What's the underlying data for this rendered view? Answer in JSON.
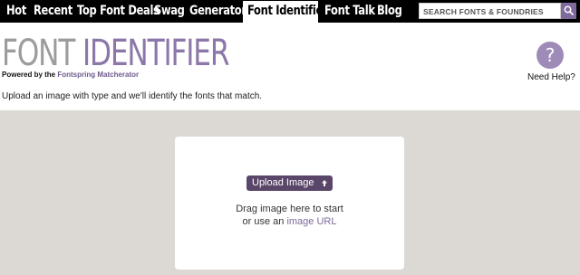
{
  "nav": {
    "items": [
      {
        "label": "Hot"
      },
      {
        "label": "Recent"
      },
      {
        "label": "Top Font Deals"
      },
      {
        "label": "Swag"
      },
      {
        "label": "Generator"
      },
      {
        "label": "Font Identifier",
        "active": true
      },
      {
        "label": "Font Talk"
      },
      {
        "label": "Blog"
      }
    ]
  },
  "search": {
    "placeholder": "SEARCH FONTS & FOUNDRIES",
    "icon": "search-icon"
  },
  "header": {
    "title_part1": "FONT",
    "title_part2": "IDENTIFIER",
    "powered_prefix": "Powered by the",
    "powered_link": "Fontspring Matcherator",
    "help_symbol": "?",
    "help_label": "Need Help?"
  },
  "intro": "Upload an image with type and we'll identify the fonts that match.",
  "upload": {
    "button_label": "Upload Image",
    "button_icon": "up-arrow-icon",
    "drag_line1": "Drag image here to start",
    "drag_line2_prefix": "or use an ",
    "drag_link": "image URL"
  },
  "colors": {
    "accent": "#8b77a8",
    "button": "#5a4668",
    "upload_bg": "#dcd9d4",
    "nav_bg": "#000000"
  }
}
